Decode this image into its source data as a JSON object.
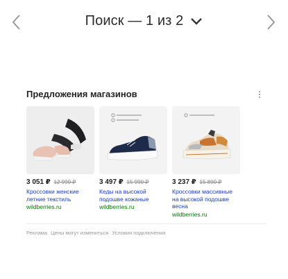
{
  "header": {
    "title": "Поиск — 1 из 2"
  },
  "icons": {
    "prev": "chevron-left-icon",
    "next": "chevron-right-icon",
    "expand": "chevron-down-icon",
    "more": "more-vertical-icon"
  },
  "offers": {
    "title": "Предложения магазинов",
    "items": [
      {
        "price": "3 051 ₽",
        "old_price": "12 990 ₽",
        "title": "Кроссовки женские летние текстиль",
        "domain": "wildberries.ru"
      },
      {
        "price": "3 497 ₽",
        "old_price": "15 990 ₽",
        "title": "Кеды на высокой подошве кожаные",
        "domain": "wildberries.ru"
      },
      {
        "price": "3 237 ₽",
        "old_price": "15 890 ₽",
        "title": "Кроссовки массивные на высокой подошве весна",
        "domain": "wildberries.ru"
      }
    ]
  },
  "footer": {
    "ad": "Реклама",
    "prices": "Цены могут измениться",
    "terms": "Условия подключения"
  },
  "colors": {
    "link": "#1a3dc1",
    "domain": "#007700",
    "muted": "#999999"
  }
}
